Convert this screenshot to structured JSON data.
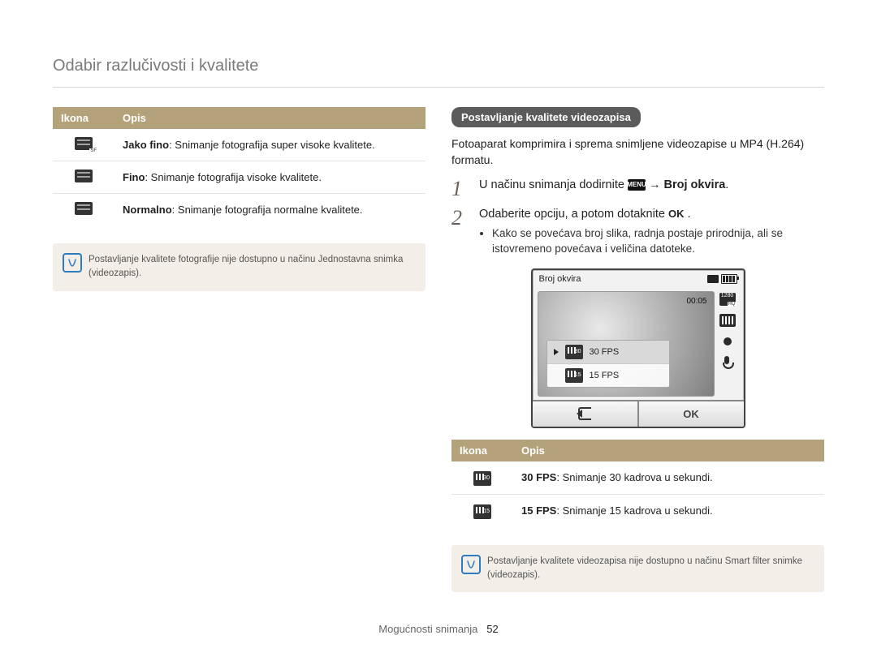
{
  "page_title": "Odabir razlučivosti i kvalitete",
  "left": {
    "table_headers": {
      "icon": "Ikona",
      "desc": "Opis"
    },
    "rows": [
      {
        "bold": "Jako fino",
        "rest": ": Snimanje fotografija super visoke kvalitete."
      },
      {
        "bold": "Fino",
        "rest": ": Snimanje fotografija visoke kvalitete."
      },
      {
        "bold": "Normalno",
        "rest": ": Snimanje fotografija normalne kvalitete."
      }
    ],
    "callout": "Postavljanje kvalitete fotografije nije dostupno u načinu Jednostavna snimka (videozapis)."
  },
  "right": {
    "section_title": "Postavljanje kvalitete videozapisa",
    "intro": "Fotoaparat komprimira i sprema snimljene videozapise u MP4 (H.264) formatu.",
    "step1_pre": "U načinu snimanja dodirnite ",
    "step1_menu": "MENU",
    "step1_arrow": " → ",
    "step1_bold": "Broj okvira",
    "step1_post": ".",
    "step2_pre": "Odaberite opciju, a potom dotaknite ",
    "step2_ok": "OK",
    "step2_post": " .",
    "bullet": "Kako se povećava broj slika, radnja postaje prirodnija, ali se istovremeno povećava i veličina datoteke.",
    "screen": {
      "title": "Broj okvira",
      "time": "00:05",
      "res_badge": "1280",
      "opt30": "30 FPS",
      "opt15": "15 FPS",
      "ok": "OK"
    },
    "table_headers": {
      "icon": "Ikona",
      "desc": "Opis"
    },
    "rows": [
      {
        "fps": "30",
        "bold": "30 FPS",
        "rest": ": Snimanje 30 kadrova u sekundi."
      },
      {
        "fps": "15",
        "bold": "15 FPS",
        "rest": ": Snimanje 15 kadrova u sekundi."
      }
    ],
    "callout": "Postavljanje kvalitete videozapisa nije dostupno u načinu Smart filter snimke (videozapis)."
  },
  "footer": {
    "section": "Mogućnosti snimanja",
    "page": "52"
  }
}
